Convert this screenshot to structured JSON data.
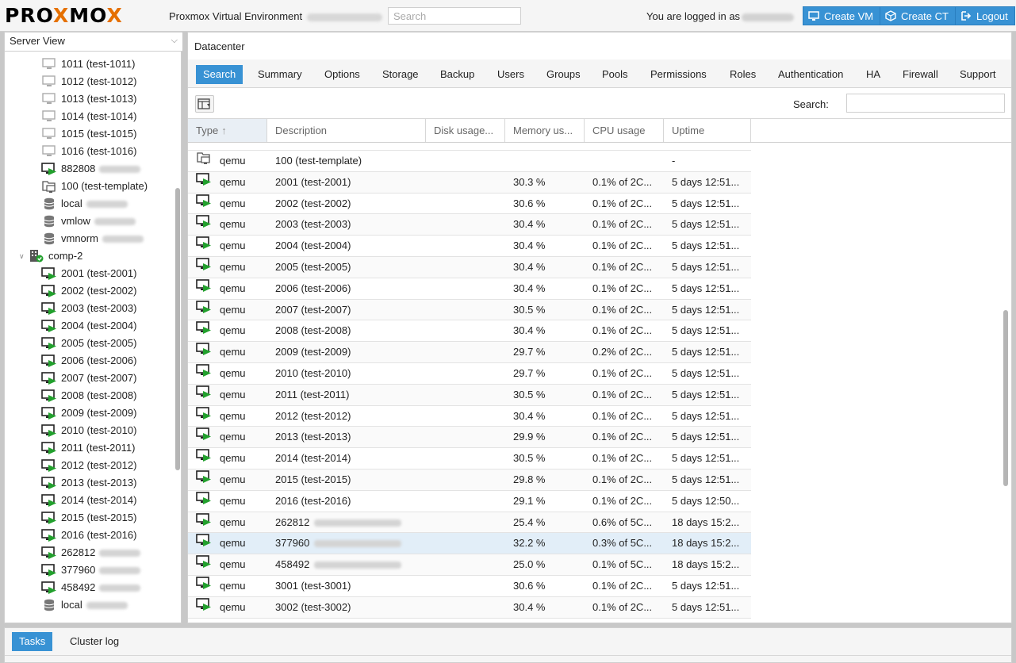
{
  "header": {
    "logo_part1": "PRO",
    "logo_x1": "X",
    "logo_part2": "MO",
    "logo_x2": "X",
    "product": "Proxmox Virtual Environment",
    "search_placeholder": "Search",
    "logged_in": "You are logged in as",
    "create_vm": "Create VM",
    "create_ct": "Create CT",
    "logout": "Logout"
  },
  "left": {
    "view": "Server View",
    "tree": [
      {
        "label": "1011 (test-1011)",
        "icon": "vm-stopped-icon",
        "indent": 1
      },
      {
        "label": "1012 (test-1012)",
        "icon": "vm-stopped-icon",
        "indent": 1
      },
      {
        "label": "1013 (test-1013)",
        "icon": "vm-stopped-icon",
        "indent": 1
      },
      {
        "label": "1014 (test-1014)",
        "icon": "vm-stopped-icon",
        "indent": 1
      },
      {
        "label": "1015 (test-1015)",
        "icon": "vm-stopped-icon",
        "indent": 1
      },
      {
        "label": "1016 (test-1016)",
        "icon": "vm-stopped-icon",
        "indent": 1
      },
      {
        "label": "882808",
        "icon": "vm-running-icon",
        "indent": 1,
        "blur": true
      },
      {
        "label": "100 (test-template)",
        "icon": "template-icon",
        "indent": 1
      },
      {
        "label": "local",
        "icon": "storage-icon",
        "indent": 1,
        "blur": true
      },
      {
        "label": "vmlow",
        "icon": "storage-icon",
        "indent": 1,
        "blur": true
      },
      {
        "label": "vmnorm",
        "icon": "storage-icon",
        "indent": 1,
        "blur": true
      },
      {
        "label": "comp-2",
        "icon": "node-online-icon",
        "indent": 0
      },
      {
        "label": "2001 (test-2001)",
        "icon": "vm-running-icon",
        "indent": 1
      },
      {
        "label": "2002 (test-2002)",
        "icon": "vm-running-icon",
        "indent": 1
      },
      {
        "label": "2003 (test-2003)",
        "icon": "vm-running-icon",
        "indent": 1
      },
      {
        "label": "2004 (test-2004)",
        "icon": "vm-running-icon",
        "indent": 1
      },
      {
        "label": "2005 (test-2005)",
        "icon": "vm-running-icon",
        "indent": 1
      },
      {
        "label": "2006 (test-2006)",
        "icon": "vm-running-icon",
        "indent": 1
      },
      {
        "label": "2007 (test-2007)",
        "icon": "vm-running-icon",
        "indent": 1
      },
      {
        "label": "2008 (test-2008)",
        "icon": "vm-running-icon",
        "indent": 1
      },
      {
        "label": "2009 (test-2009)",
        "icon": "vm-running-icon",
        "indent": 1
      },
      {
        "label": "2010 (test-2010)",
        "icon": "vm-running-icon",
        "indent": 1
      },
      {
        "label": "2011 (test-2011)",
        "icon": "vm-running-icon",
        "indent": 1
      },
      {
        "label": "2012 (test-2012)",
        "icon": "vm-running-icon",
        "indent": 1
      },
      {
        "label": "2013 (test-2013)",
        "icon": "vm-running-icon",
        "indent": 1
      },
      {
        "label": "2014 (test-2014)",
        "icon": "vm-running-icon",
        "indent": 1
      },
      {
        "label": "2015 (test-2015)",
        "icon": "vm-running-icon",
        "indent": 1
      },
      {
        "label": "2016 (test-2016)",
        "icon": "vm-running-icon",
        "indent": 1
      },
      {
        "label": "262812",
        "icon": "vm-running-icon",
        "indent": 1,
        "blur": true
      },
      {
        "label": "377960",
        "icon": "vm-running-icon",
        "indent": 1,
        "blur": true
      },
      {
        "label": "458492",
        "icon": "vm-running-icon",
        "indent": 1,
        "blur": true
      },
      {
        "label": "local",
        "icon": "storage-icon",
        "indent": 1,
        "blur": true
      }
    ]
  },
  "main": {
    "title": "Datacenter",
    "tabs": [
      "Search",
      "Summary",
      "Options",
      "Storage",
      "Backup",
      "Users",
      "Groups",
      "Pools",
      "Permissions",
      "Roles",
      "Authentication",
      "HA",
      "Firewall",
      "Support"
    ],
    "active_tab": "Search",
    "search_label": "Search:",
    "columns": [
      "Type",
      "Description",
      "Disk usage...",
      "Memory us...",
      "CPU usage",
      "Uptime"
    ],
    "rows": [
      {
        "type": "qemu",
        "desc": "100 (test-template)",
        "mem": "",
        "cpu": "",
        "uptime": "-",
        "icon": "template-icon"
      },
      {
        "type": "qemu",
        "desc": "2001 (test-2001)",
        "mem": "30.3 %",
        "cpu": "0.1% of 2C...",
        "uptime": "5 days 12:51...",
        "icon": "vm-running-icon"
      },
      {
        "type": "qemu",
        "desc": "2002 (test-2002)",
        "mem": "30.6 %",
        "cpu": "0.1% of 2C...",
        "uptime": "5 days 12:51...",
        "icon": "vm-running-icon"
      },
      {
        "type": "qemu",
        "desc": "2003 (test-2003)",
        "mem": "30.4 %",
        "cpu": "0.1% of 2C...",
        "uptime": "5 days 12:51...",
        "icon": "vm-running-icon"
      },
      {
        "type": "qemu",
        "desc": "2004 (test-2004)",
        "mem": "30.4 %",
        "cpu": "0.1% of 2C...",
        "uptime": "5 days 12:51...",
        "icon": "vm-running-icon"
      },
      {
        "type": "qemu",
        "desc": "2005 (test-2005)",
        "mem": "30.4 %",
        "cpu": "0.1% of 2C...",
        "uptime": "5 days 12:51...",
        "icon": "vm-running-icon"
      },
      {
        "type": "qemu",
        "desc": "2006 (test-2006)",
        "mem": "30.4 %",
        "cpu": "0.1% of 2C...",
        "uptime": "5 days 12:51...",
        "icon": "vm-running-icon"
      },
      {
        "type": "qemu",
        "desc": "2007 (test-2007)",
        "mem": "30.5 %",
        "cpu": "0.1% of 2C...",
        "uptime": "5 days 12:51...",
        "icon": "vm-running-icon"
      },
      {
        "type": "qemu",
        "desc": "2008 (test-2008)",
        "mem": "30.4 %",
        "cpu": "0.1% of 2C...",
        "uptime": "5 days 12:51...",
        "icon": "vm-running-icon"
      },
      {
        "type": "qemu",
        "desc": "2009 (test-2009)",
        "mem": "29.7 %",
        "cpu": "0.2% of 2C...",
        "uptime": "5 days 12:51...",
        "icon": "vm-running-icon"
      },
      {
        "type": "qemu",
        "desc": "2010 (test-2010)",
        "mem": "29.7 %",
        "cpu": "0.1% of 2C...",
        "uptime": "5 days 12:51...",
        "icon": "vm-running-icon"
      },
      {
        "type": "qemu",
        "desc": "2011 (test-2011)",
        "mem": "30.5 %",
        "cpu": "0.1% of 2C...",
        "uptime": "5 days 12:51...",
        "icon": "vm-running-icon"
      },
      {
        "type": "qemu",
        "desc": "2012 (test-2012)",
        "mem": "30.4 %",
        "cpu": "0.1% of 2C...",
        "uptime": "5 days 12:51...",
        "icon": "vm-running-icon"
      },
      {
        "type": "qemu",
        "desc": "2013 (test-2013)",
        "mem": "29.9 %",
        "cpu": "0.1% of 2C...",
        "uptime": "5 days 12:51...",
        "icon": "vm-running-icon"
      },
      {
        "type": "qemu",
        "desc": "2014 (test-2014)",
        "mem": "30.5 %",
        "cpu": "0.1% of 2C...",
        "uptime": "5 days 12:51...",
        "icon": "vm-running-icon"
      },
      {
        "type": "qemu",
        "desc": "2015 (test-2015)",
        "mem": "29.8 %",
        "cpu": "0.1% of 2C...",
        "uptime": "5 days 12:51...",
        "icon": "vm-running-icon"
      },
      {
        "type": "qemu",
        "desc": "2016 (test-2016)",
        "mem": "29.1 %",
        "cpu": "0.1% of 2C...",
        "uptime": "5 days 12:50...",
        "icon": "vm-running-icon"
      },
      {
        "type": "qemu",
        "desc": "262812",
        "mem": "25.4 %",
        "cpu": "0.6% of 5C...",
        "uptime": "18 days 15:2...",
        "icon": "vm-running-icon",
        "blur": true
      },
      {
        "type": "qemu",
        "desc": "377960",
        "mem": "32.2 %",
        "cpu": "0.3% of 5C...",
        "uptime": "18 days 15:2...",
        "icon": "vm-running-icon",
        "blur": true,
        "selected": true
      },
      {
        "type": "qemu",
        "desc": "458492",
        "mem": "25.0 %",
        "cpu": "0.1% of 5C...",
        "uptime": "18 days 15:2...",
        "icon": "vm-running-icon",
        "blur": true
      },
      {
        "type": "qemu",
        "desc": "3001 (test-3001)",
        "mem": "30.6 %",
        "cpu": "0.1% of 2C...",
        "uptime": "5 days 12:51...",
        "icon": "vm-running-icon"
      },
      {
        "type": "qemu",
        "desc": "3002 (test-3002)",
        "mem": "30.4 %",
        "cpu": "0.1% of 2C...",
        "uptime": "5 days 12:51...",
        "icon": "vm-running-icon"
      }
    ]
  },
  "bottom": {
    "tabs": [
      "Tasks",
      "Cluster log"
    ],
    "active_tab": "Tasks"
  },
  "colors": {
    "accent": "#3892d4",
    "running_green": "#22a02d",
    "logo_x": "#e57000"
  }
}
